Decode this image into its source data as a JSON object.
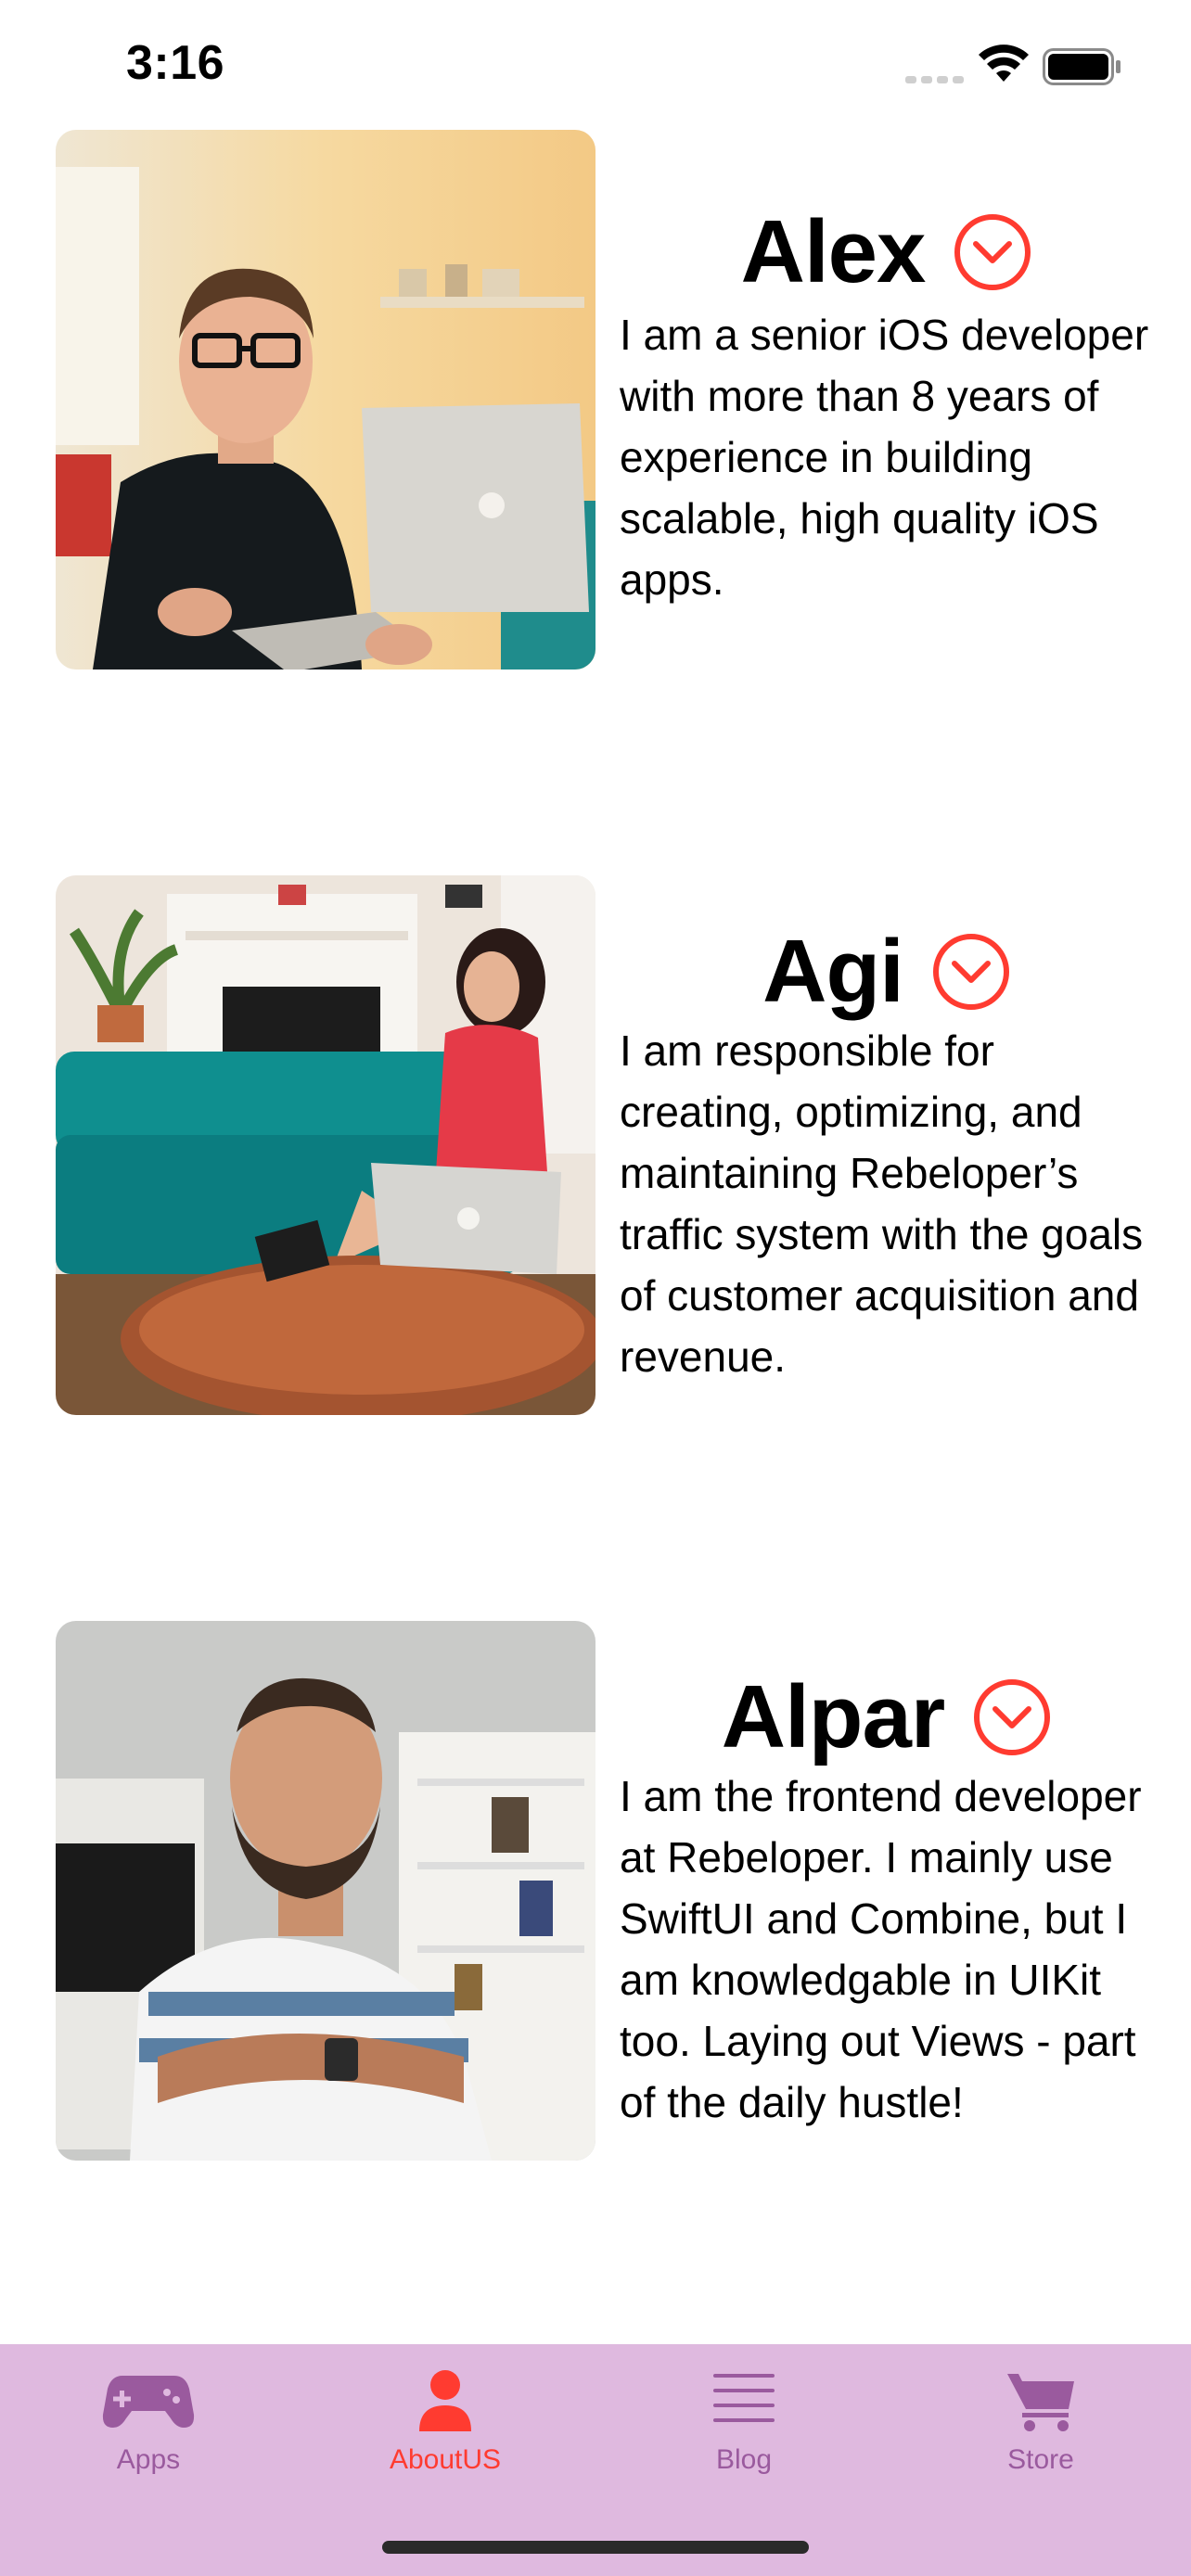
{
  "status_bar": {
    "time": "3:16"
  },
  "profiles": [
    {
      "name": "Alex",
      "bio": "I am a senior iOS developer with more than 8 years of experience in building scalable, high quality iOS apps.",
      "expand_icon": "chevron-down-circle-icon"
    },
    {
      "name": "Agi",
      "bio": "I am responsible for creating, optimizing, and maintaining Rebeloper’s traffic system with the goals of customer acquisition and revenue.",
      "expand_icon": "chevron-down-circle-icon"
    },
    {
      "name": "Alpar",
      "bio": "I am the frontend developer at Rebeloper. I mainly use SwiftUI and Combine, but I am knowledgable in UIKit too. Laying out Views - part of the daily hustle!",
      "expand_icon": "chevron-down-circle-icon"
    }
  ],
  "tab_bar": {
    "tabs": [
      {
        "label": "Apps",
        "icon": "gamecontroller-icon",
        "active": false
      },
      {
        "label": "AboutUS",
        "icon": "person-icon",
        "active": true
      },
      {
        "label": "Blog",
        "icon": "list-lines-icon",
        "active": false
      },
      {
        "label": "Store",
        "icon": "cart-icon",
        "active": false
      }
    ]
  },
  "colors": {
    "accent": "#ff3b30",
    "tab_bar_background": "#dfb9df",
    "tab_inactive": "#9a5a9e"
  }
}
